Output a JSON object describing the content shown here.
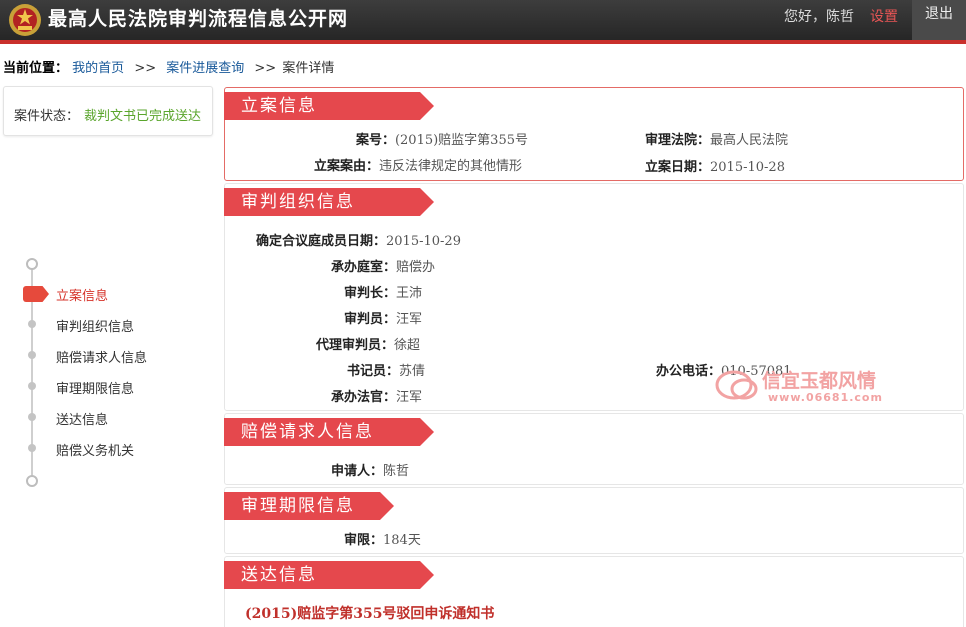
{
  "header": {
    "site_title": "最高人民法院审判流程信息公开网",
    "greeting": "您好，陈哲",
    "settings_label": "设置",
    "logout_label": "退出"
  },
  "breadcrumb": {
    "title": "当前位置：",
    "home": "我的首页",
    "progress": "案件进展查询",
    "detail": "案件详情",
    "sep1": ">>",
    "sep2": ">>"
  },
  "status": {
    "label": "案件状态：",
    "value": "裁判文书已完成送达"
  },
  "sidebar": {
    "items": [
      {
        "label": "立案信息"
      },
      {
        "label": "审判组织信息"
      },
      {
        "label": "赔偿请求人信息"
      },
      {
        "label": "审理期限信息"
      },
      {
        "label": "送达信息"
      },
      {
        "label": "赔偿义务机关"
      }
    ]
  },
  "filing": {
    "title": "立案信息",
    "case_no_label": "案号：",
    "case_no": "(2015)赔监字第355号",
    "court_label": "审理法院：",
    "court": "最高人民法院",
    "cause_label": "立案案由：",
    "cause": "违反法律规定的其他情形",
    "date_label": "立案日期：",
    "date": "2015-10-28"
  },
  "tribunal": {
    "title": "审判组织信息",
    "collegial_date_label": "确定合议庭成员日期：",
    "collegial_date": "2015-10-29",
    "chamber_label": "承办庭室：",
    "chamber": "赔偿办",
    "chief_label": "审判长：",
    "chief": "王沛",
    "judge_label": "审判员：",
    "judge": "汪军",
    "acting_label": "代理审判员：",
    "acting": "徐超",
    "clerk_label": "书记员：",
    "clerk": "苏倩",
    "phone_label": "办公电话：",
    "phone": "010-57081",
    "handler_label": "承办法官：",
    "handler": "汪军"
  },
  "claimant": {
    "title": "赔偿请求人信息",
    "applicant_label": "申请人：",
    "applicant": "陈哲"
  },
  "term": {
    "title": "审理期限信息",
    "limit_label": "审限：",
    "limit": "184天"
  },
  "delivery": {
    "title": "送达信息",
    "doc_title": "(2015)赔监字第355号驳回申诉通知书"
  },
  "watermark": {
    "text": "信宜玉都风情",
    "url": "www.06681.com"
  },
  "colors": {
    "accent": "#e5484d",
    "topbar": "#2f2f2f",
    "status_green": "#5aa52c",
    "link_blue": "#1a5a9a"
  }
}
